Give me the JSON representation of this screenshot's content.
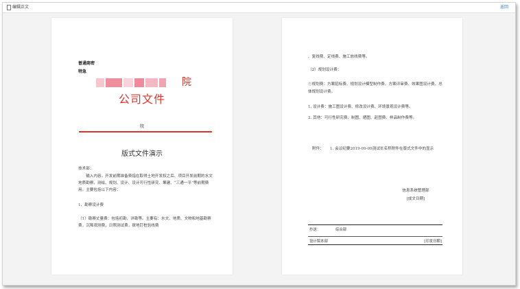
{
  "window": {
    "title": "编辑正文",
    "back_label": "返回",
    "icon": "document-icon"
  },
  "left_page": {
    "secret_level": "普通商密",
    "urgency": "特急",
    "org_name_suffix": "院",
    "company_title": "公司文件",
    "issuer": "院",
    "doc_title": "版式文件演示",
    "recipient": "技术部：",
    "paragraph1": "输入内容。开发前期准备费指在取得土地开发权之后、项目开发前期的水文地质勘察、测绘、规划、设计、设计可行性研究、筹建、“三通一平”等前期费用。主要包括以下内容：",
    "heading1": "1、勘察设计费",
    "paragraph2": "（1）勘察丈量费：包括初勘、详勘等。主要有：水文、地质、文物和地基勘察费，沉降观测费，日照测试费，拨地钉桩验线费"
  },
  "right_page": {
    "line1": "、复线费、定线费、施工放线费等。",
    "line2": "（2）规划设计费：",
    "line3": "①规划费：方案招标费、规划设计模型制作费、方案评审费、效果图设计费、总体规划设计费。",
    "item1": "1. 设计费：施工图设计费、修改设计费、环境景观设计费等。",
    "item2": "2. 其他：可行性研究费、制图、晒图、赶图费、样品制作费等。",
    "attachment_label": "附件：",
    "attachment_text": "1. 会议纪要2019-09-09测试长名称附件在版式文件中的显示",
    "sign_dept": "信息系统管理部",
    "sign_date": "[成文日期]",
    "cc_label": "抄送：",
    "cc_value": "综合部",
    "print_org": "设计院本部",
    "print_date": "[印发日期]"
  },
  "colors": {
    "red_heading": "#e1322a",
    "link_blue": "#3b7dd8"
  }
}
